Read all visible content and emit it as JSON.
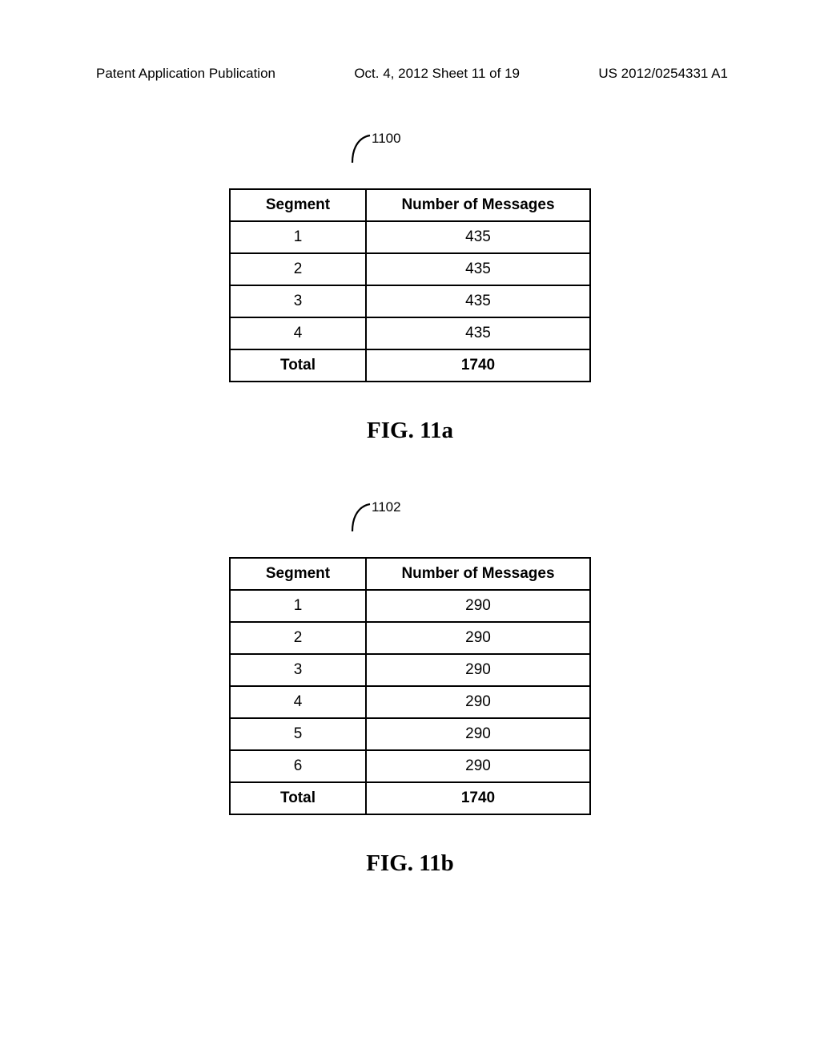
{
  "header": {
    "left": "Patent Application Publication",
    "center": "Oct. 4, 2012   Sheet 11 of 19",
    "right": "US 2012/0254331 A1"
  },
  "figure_a": {
    "ref_num": "1100",
    "caption": "FIG. 11a",
    "table": {
      "headers": [
        "Segment",
        "Number of Messages"
      ],
      "rows": [
        {
          "segment": "1",
          "messages": "435"
        },
        {
          "segment": "2",
          "messages": "435"
        },
        {
          "segment": "3",
          "messages": "435"
        },
        {
          "segment": "4",
          "messages": "435"
        }
      ],
      "total": {
        "label": "Total",
        "value": "1740"
      }
    }
  },
  "figure_b": {
    "ref_num": "1102",
    "caption": "FIG. 11b",
    "table": {
      "headers": [
        "Segment",
        "Number of Messages"
      ],
      "rows": [
        {
          "segment": "1",
          "messages": "290"
        },
        {
          "segment": "2",
          "messages": "290"
        },
        {
          "segment": "3",
          "messages": "290"
        },
        {
          "segment": "4",
          "messages": "290"
        },
        {
          "segment": "5",
          "messages": "290"
        },
        {
          "segment": "6",
          "messages": "290"
        }
      ],
      "total": {
        "label": "Total",
        "value": "1740"
      }
    }
  }
}
